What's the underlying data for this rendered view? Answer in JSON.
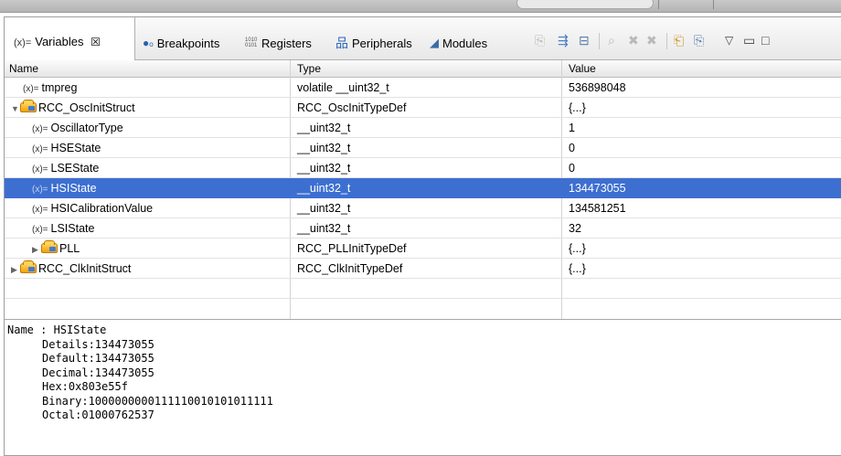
{
  "tabs": [
    {
      "label": "Variables",
      "prefix": "(x)=",
      "close": "☒"
    },
    {
      "label": "Breakpoints",
      "icon": "breakpoints-icon"
    },
    {
      "label": "Registers",
      "icon": "registers-icon"
    },
    {
      "label": "Peripherals",
      "icon": "peripherals-icon"
    },
    {
      "label": "Modules",
      "icon": "modules-icon"
    }
  ],
  "columns": {
    "name": "Name",
    "type": "Type",
    "value": "Value"
  },
  "rows": [
    {
      "name": "tmpreg",
      "type": "volatile __uint32_t",
      "value": "536898048"
    },
    {
      "name": "RCC_OscInitStruct",
      "type": "RCC_OscInitTypeDef",
      "value": "{...}"
    },
    {
      "name": "OscillatorType",
      "type": "__uint32_t",
      "value": "1"
    },
    {
      "name": "HSEState",
      "type": "__uint32_t",
      "value": "0"
    },
    {
      "name": "LSEState",
      "type": "__uint32_t",
      "value": "0"
    },
    {
      "name": "HSIState",
      "type": "__uint32_t",
      "value": "134473055"
    },
    {
      "name": "HSICalibrationValue",
      "type": "__uint32_t",
      "value": "134581251"
    },
    {
      "name": "LSIState",
      "type": "__uint32_t",
      "value": "32"
    },
    {
      "name": "PLL",
      "type": "RCC_PLLInitTypeDef",
      "value": "{...}"
    },
    {
      "name": "RCC_ClkInitStruct",
      "type": "RCC_ClkInitTypeDef",
      "value": "{...}"
    }
  ],
  "details": {
    "name": "Name : HSIState",
    "details": "Details:134473055",
    "default": "Default:134473055",
    "decimal": "Decimal:134473055",
    "hex": "Hex:0x803e55f",
    "binary": "Binary:1000000000111110010101011111",
    "octal": "Octal:01000762537"
  },
  "toolbar_icons": [
    "collapse-all-icon",
    "show-type-names-icon",
    "layout-icon",
    "disconnect-icon",
    "remove-icon",
    "remove-all-icon",
    "add-variable-icon",
    "add-expression-icon",
    "view-menu-icon",
    "minimize-icon",
    "maximize-icon"
  ]
}
